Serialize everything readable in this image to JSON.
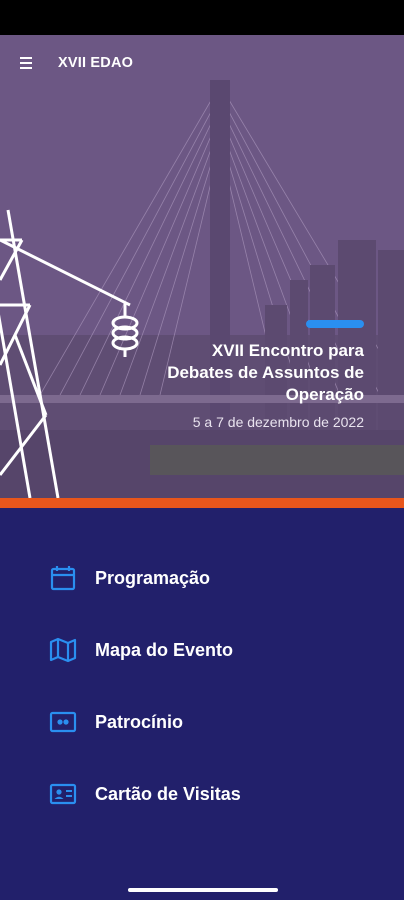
{
  "app": {
    "title": "XVII EDAO"
  },
  "hero": {
    "title": "XVII Encontro para Debates de Assuntos de Operação",
    "date": "5 a 7 de dezembro de 2022"
  },
  "menu": {
    "items": [
      {
        "label": "Programação",
        "icon": "calendar-icon"
      },
      {
        "label": "Mapa do Evento",
        "icon": "map-icon"
      },
      {
        "label": "Patrocínio",
        "icon": "ticket-icon"
      },
      {
        "label": "Cartão de Visitas",
        "icon": "contact-card-icon"
      }
    ]
  },
  "colors": {
    "primary": "#22206b",
    "accent_blue": "#2a8ff0",
    "accent_orange": "#e8561c",
    "hero_overlay": "#6f5a86"
  }
}
